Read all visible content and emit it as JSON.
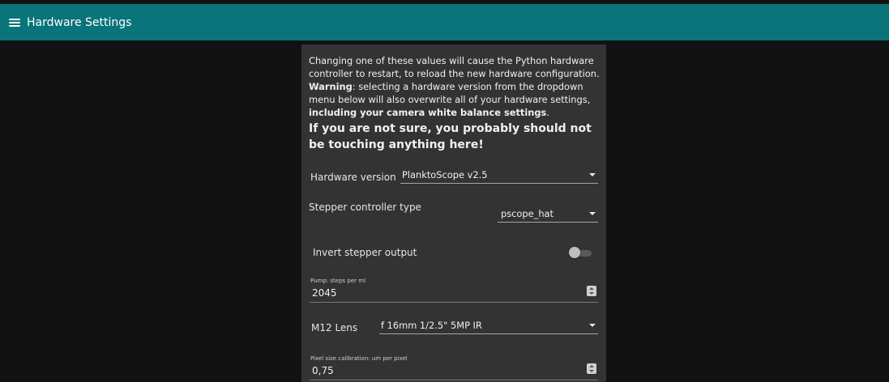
{
  "header": {
    "title": "Hardware Settings",
    "icon": "menu-icon",
    "bg_color": "#097479"
  },
  "notice": {
    "line1": "Changing one of these values will cause the Python hardware controller to restart, to reload the new hardware configuration.",
    "warning_bold": "Warning",
    "warning_text": ": selecting a hardware version from the dropdown menu below will also overwrite all of your hardware settings, ",
    "warning_bold2": "including your camera white balance settings",
    "warning_end": ".",
    "strong": "If you are not sure, you probably should not be touching anything here!"
  },
  "hardware_version": {
    "label": "Hardware version",
    "value": "PlanktoScope v2.5"
  },
  "stepper_type": {
    "label": "Stepper controller type",
    "value": "pscope_hat"
  },
  "invert_stepper": {
    "label": "Invert stepper output",
    "enabled": false
  },
  "pump_steps": {
    "label": "Pump: steps per ml",
    "value": "2045"
  },
  "lens": {
    "label": "M12 Lens",
    "value": "f 16mm 1/2.5\" 5MP IR"
  },
  "pixel_size": {
    "label": "Pixel size calibration: um per pixel",
    "value": "0,75"
  }
}
